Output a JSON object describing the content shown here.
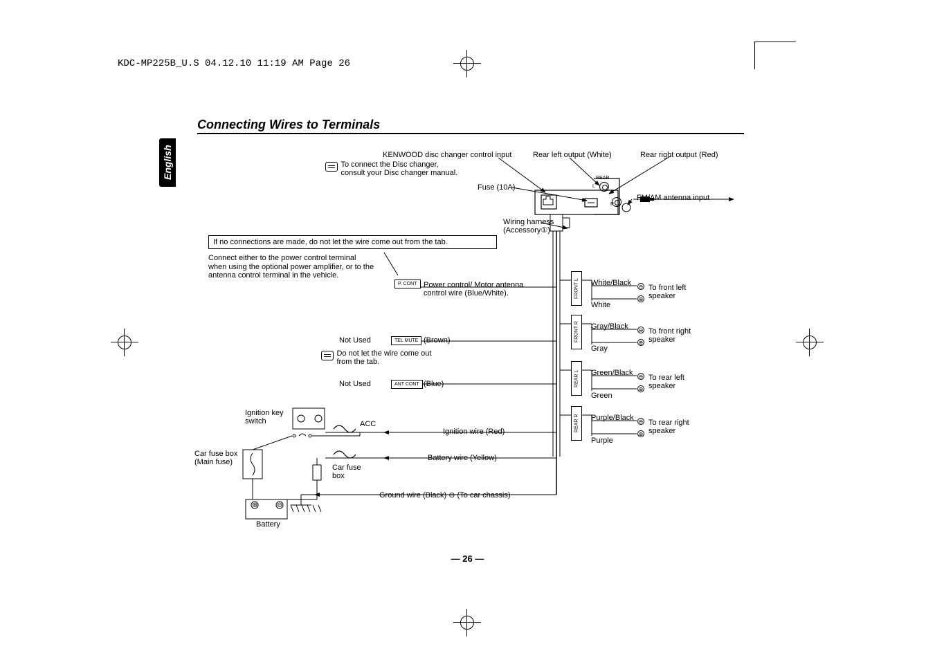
{
  "header": "KDC-MP225B_U.S  04.12.10  11:19 AM  Page 26",
  "section_title": "Connecting Wires to Terminals",
  "language_tab": "English",
  "page_number": "— 26 —",
  "labels": {
    "disc_changer_input": "KENWOOD disc changer control input",
    "disc_changer_note": "To connect the Disc changer, consult your Disc changer manual.",
    "rear_left_output": "Rear left output (White)",
    "rear_right_output": "Rear right output (Red)",
    "fuse": "Fuse (10A)",
    "rear_mark": "REAR",
    "rca_l": "L",
    "rca_r": "R",
    "fm_am_antenna": "FM/AM antenna input",
    "wiring_harness": "Wiring harness",
    "accessory1": "(Accessory①)",
    "no_conn_warning": "If no connections are made, do not let the wire come out from the tab.",
    "connect_power_note": "Connect either to the power control terminal when using the optional power amplifier, or to the antenna control terminal in the vehicle.",
    "pcont_tag": "P. CONT",
    "pcont_label": "Power control/ Motor antenna control wire (Blue/White).",
    "not_used_1": "Not Used",
    "telmute_tag": "TEL MUTE",
    "telmute_color": "(Brown)",
    "dont_let_wire": "Do not let the wire come out from the tab.",
    "not_used_2": "Not Used",
    "antcont_tag": "ANT CONT",
    "antcont_color": "(Blue)",
    "ignition_key": "Ignition key switch",
    "acc": "ACC",
    "ignition_wire": "Ignition wire (Red)",
    "battery_wire": "Battery wire (Yellow)",
    "car_fuse_main": "Car fuse box",
    "car_fuse_main2": "(Main fuse)",
    "car_fuse_box": "Car fuse box",
    "ground_wire": "Ground wire (Black) ⊖ (To car chassis)",
    "battery": "Battery",
    "speakers": {
      "fl_tag": "FRONT  L",
      "fr_tag": "FRONT  R",
      "rl_tag": "REAR  L",
      "rr_tag": "REAR  R",
      "fl_neg": "White/Black",
      "fl_pos": "White",
      "fl_dest": "To front left speaker",
      "fr_neg": "Gray/Black",
      "fr_pos": "Gray",
      "fr_dest": "To front right speaker",
      "rl_neg": "Green/Black",
      "rl_pos": "Green",
      "rl_dest": "To rear left speaker",
      "rr_neg": "Purple/Black",
      "rr_pos": "Purple",
      "rr_dest": "To rear right speaker"
    },
    "polarity_minus": "⊖",
    "polarity_plus": "⊕",
    "batt_plus": "⊕",
    "batt_minus": "⊖"
  }
}
